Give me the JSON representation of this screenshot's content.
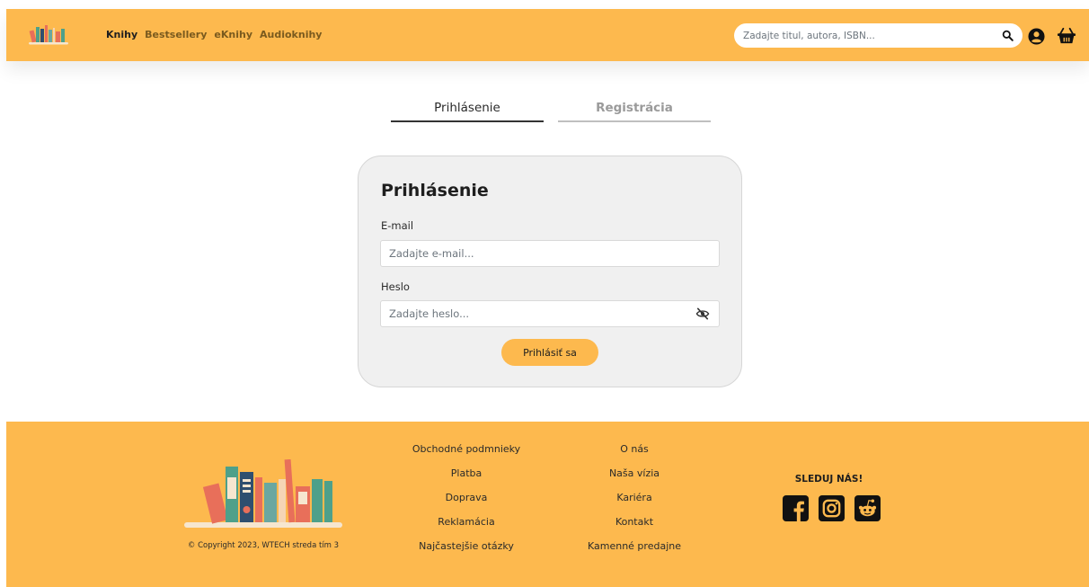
{
  "header": {
    "nav": [
      {
        "label": "Knihy",
        "active": true
      },
      {
        "label": "Bestsellery",
        "active": false
      },
      {
        "label": "eKnihy",
        "active": false
      },
      {
        "label": "Audioknihy",
        "active": false
      }
    ],
    "search_placeholder": "Zadajte titul, autora, ISBN...",
    "icons": [
      "search-icon",
      "user-icon",
      "basket-icon"
    ]
  },
  "tabs": [
    {
      "label": "Prihlásenie",
      "active": true
    },
    {
      "label": "Registrácia",
      "active": false
    }
  ],
  "login": {
    "title": "Prihlásenie",
    "email_label": "E-mail",
    "email_placeholder": "Zadajte e-mail...",
    "password_label": "Heslo",
    "password_placeholder": "Zadajte heslo...",
    "submit_label": "Prihlásiť sa"
  },
  "footer": {
    "copyright": "© Copyright 2023, WTECH streda tím 3",
    "col1": [
      "Obchodné podmnieky",
      "Platba",
      "Doprava",
      "Reklamácia",
      "Najčastejšie otázky"
    ],
    "col2": [
      "O nás",
      "Naša vízia",
      "Kariéra",
      "Kontakt",
      "Kamenné predajne"
    ],
    "follow_label": "SLEDUJ NÁS!",
    "socials": [
      "facebook-icon",
      "instagram-icon",
      "reddit-icon"
    ]
  },
  "colors": {
    "brand": "#fdb94e",
    "card_bg": "#f0f0f0",
    "text": "#1e1e1e"
  }
}
